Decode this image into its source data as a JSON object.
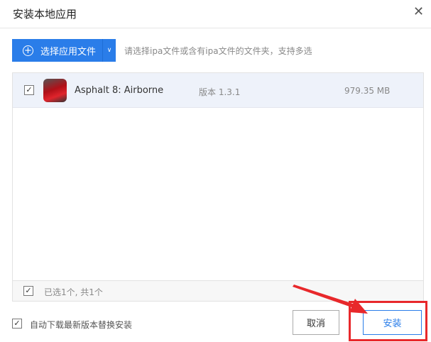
{
  "dialog": {
    "title": "安装本地应用",
    "close_icon": "close-icon"
  },
  "toolbar": {
    "select_label": "选择应用文件",
    "hint": "请选择ipa文件或含有ipa文件的文件夹，支持多选"
  },
  "apps": [
    {
      "checked": true,
      "name": "Asphalt 8: Airborne",
      "version": "版本 1.3.1",
      "size": "979.35 MB"
    }
  ],
  "list_footer": {
    "checked": true,
    "summary": "已选1个, 共1个"
  },
  "footer": {
    "auto_update_checked": true,
    "auto_update_label": "自动下载最新版本替换安装",
    "cancel_label": "取消",
    "install_label": "安装"
  },
  "colors": {
    "accent": "#2a7de9",
    "annotation": "#e8282b"
  }
}
